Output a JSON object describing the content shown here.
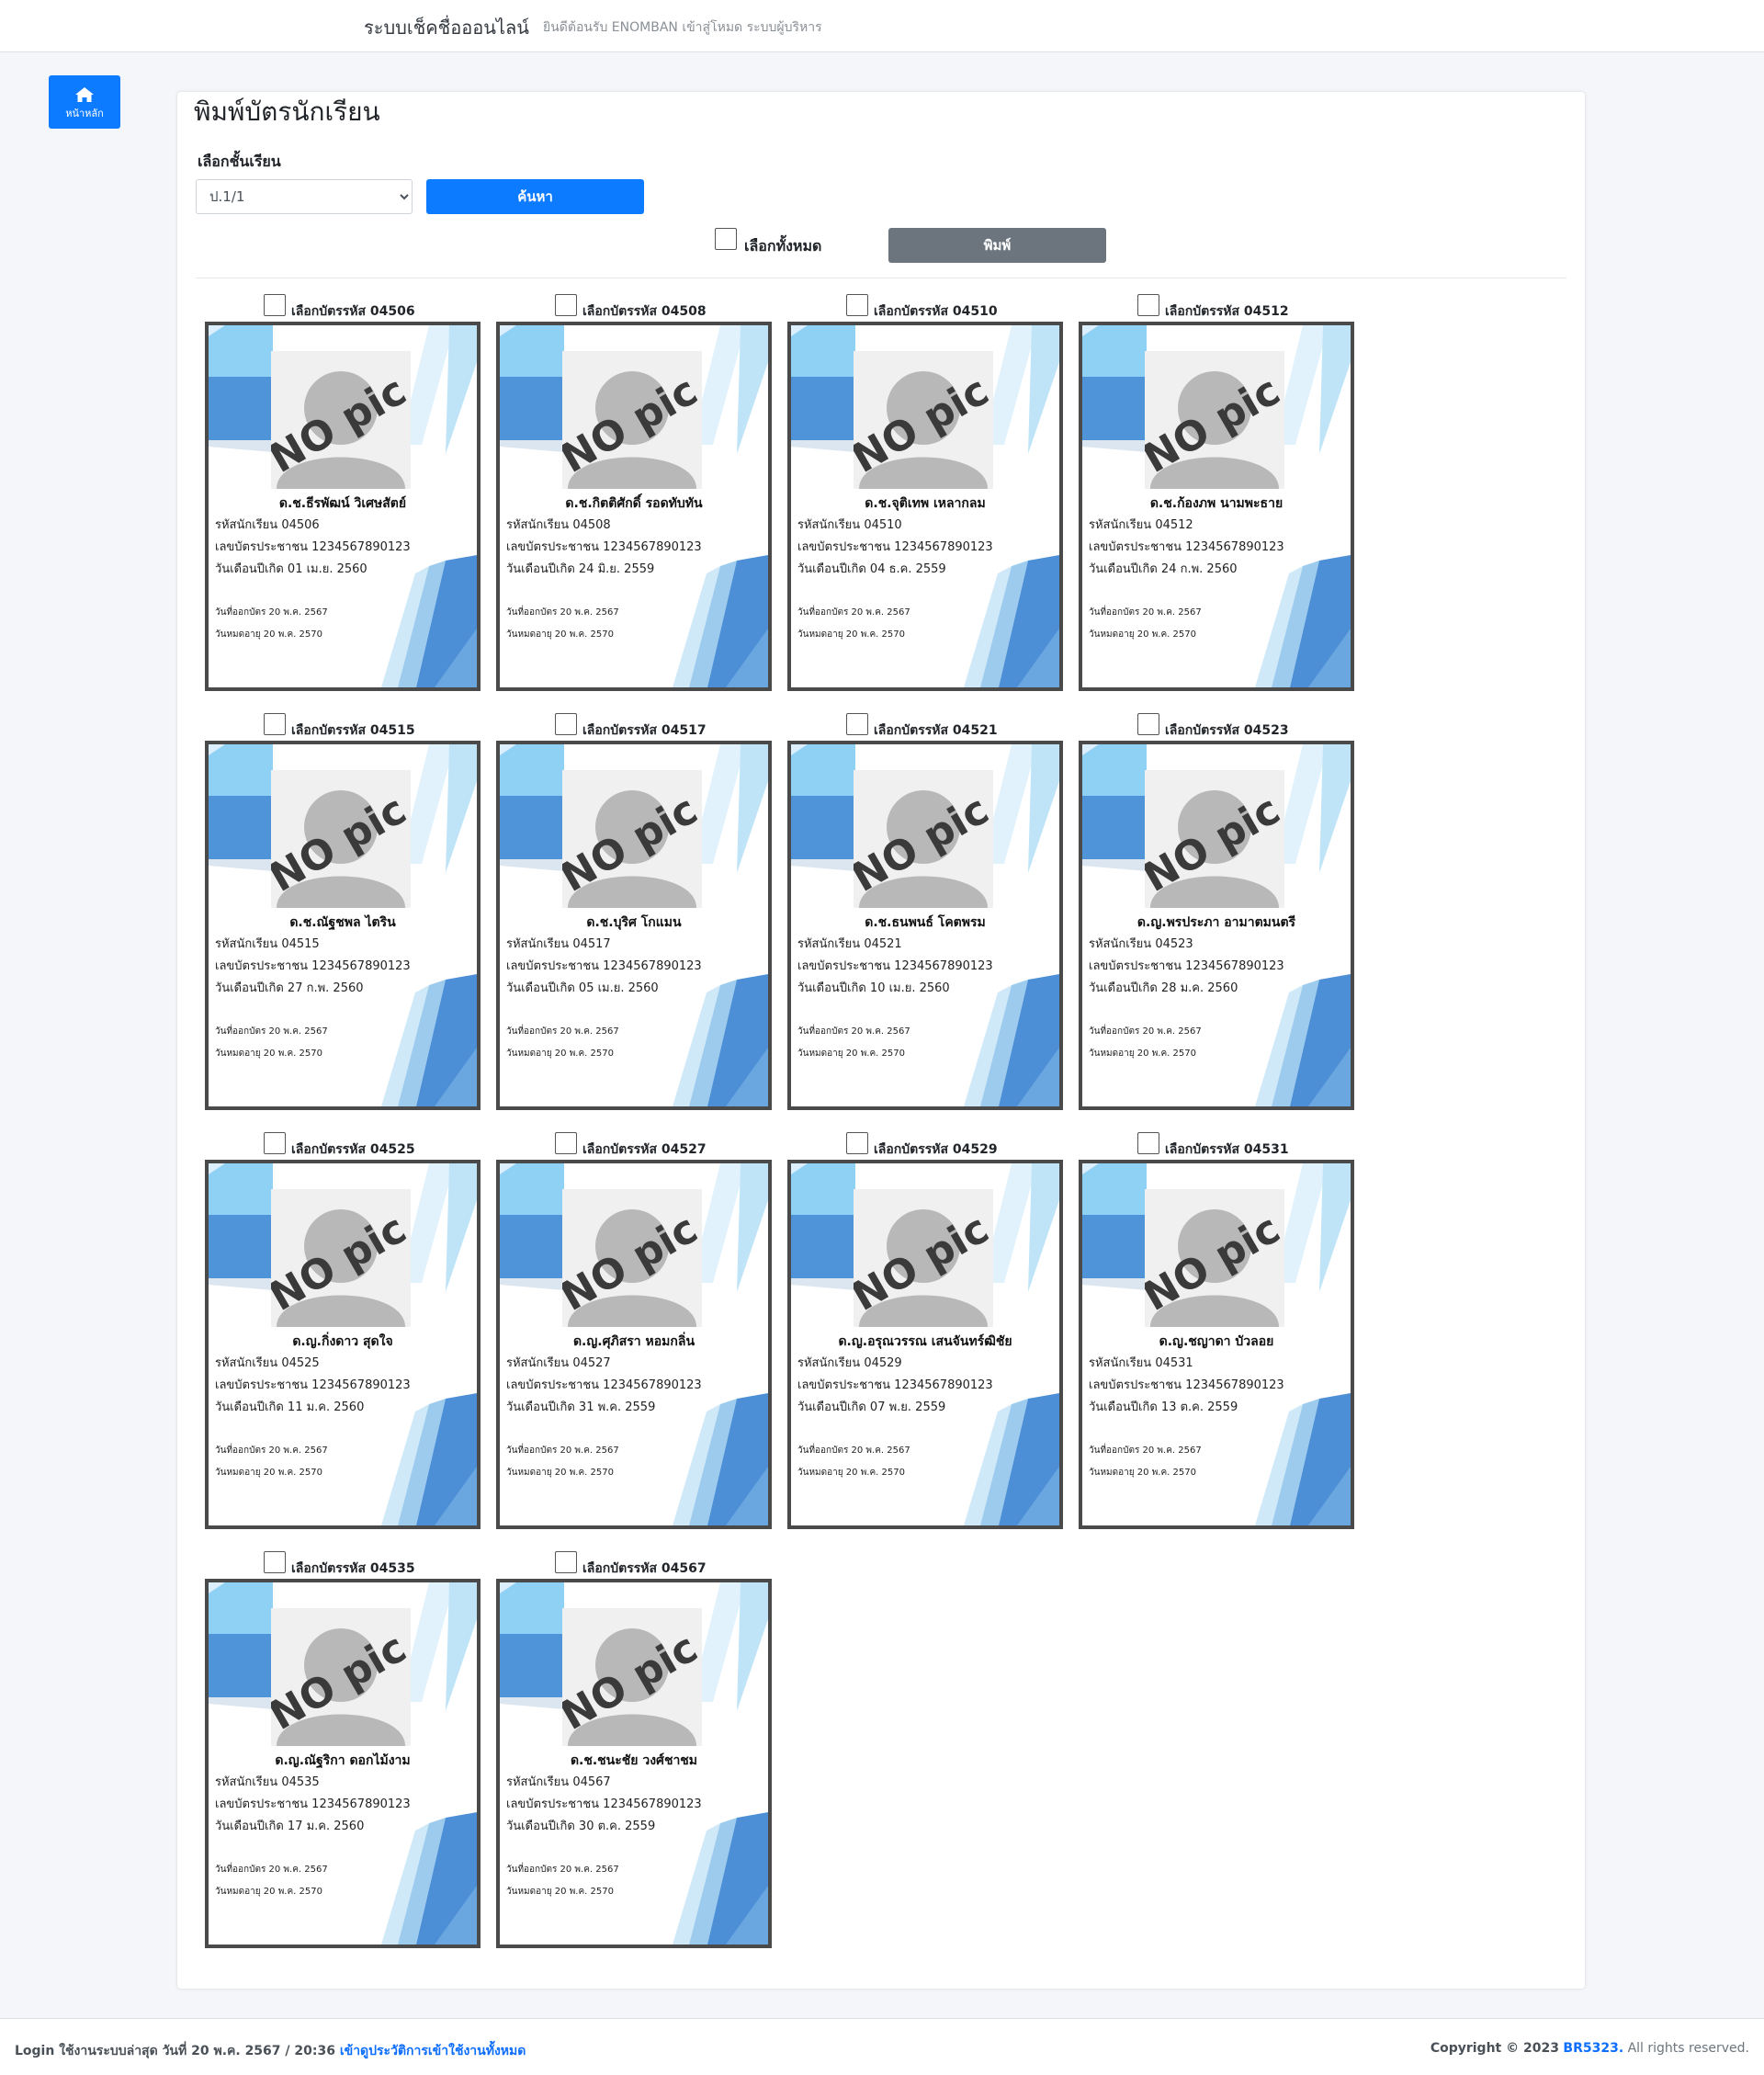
{
  "header": {
    "brand": "ระบบเช็คชื่อออนไลน์",
    "welcome": "ยินดีต้อนรับ ENOMBAN เข้าสู่โหมด ระบบผู้บริหาร"
  },
  "sidebar": {
    "home_label": "หน้าหลัก",
    "home_icon": "home-icon"
  },
  "main": {
    "title": "พิมพ์บัตรนักเรียน",
    "class_label": "เลือกชั้นเรียน",
    "class_selected": "ป.1/1",
    "search_label": "ค้นหา",
    "select_all_label": "เลือกทั้งหมด",
    "print_label": "พิมพ์"
  },
  "card_labels": {
    "select_prefix": "เลือกบัตรรหัส",
    "student_id": "รหัสนักเรียน",
    "national_id": "เลขบัตรประชาชน",
    "birth_date": "วันเดือนปีเกิด",
    "issue_date": "วันที่ออกบัตร",
    "expiry_date": "วันหมดอายุ",
    "photo_placeholder": "NO pic"
  },
  "cards": [
    {
      "code": "04506",
      "name": "ด.ช.ธีรพัฒน์ วิเศษสัตย์",
      "national_id": "1234567890123",
      "birth": "01 เม.ย. 2560",
      "issued": "20 พ.ค. 2567",
      "expires": "20 พ.ค. 2570"
    },
    {
      "code": "04508",
      "name": "ด.ช.กิตติศักดิ์ รอดทับทัน",
      "national_id": "1234567890123",
      "birth": "24 มิ.ย. 2559",
      "issued": "20 พ.ค. 2567",
      "expires": "20 พ.ค. 2570"
    },
    {
      "code": "04510",
      "name": "ด.ช.จุติเทพ เหลากลม",
      "national_id": "1234567890123",
      "birth": "04 ธ.ค. 2559",
      "issued": "20 พ.ค. 2567",
      "expires": "20 พ.ค. 2570"
    },
    {
      "code": "04512",
      "name": "ด.ช.ก้องภพ นามพะธาย",
      "national_id": "1234567890123",
      "birth": "24 ก.พ. 2560",
      "issued": "20 พ.ค. 2567",
      "expires": "20 พ.ค. 2570"
    },
    {
      "code": "04515",
      "name": "ด.ช.ณัฐชพล ไตริน",
      "national_id": "1234567890123",
      "birth": "27 ก.พ. 2560",
      "issued": "20 พ.ค. 2567",
      "expires": "20 พ.ค. 2570"
    },
    {
      "code": "04517",
      "name": "ด.ช.บุริศ โกแมน",
      "national_id": "1234567890123",
      "birth": "05 เม.ย. 2560",
      "issued": "20 พ.ค. 2567",
      "expires": "20 พ.ค. 2570"
    },
    {
      "code": "04521",
      "name": "ด.ช.ธนพนธ์ โคตพรม",
      "national_id": "1234567890123",
      "birth": "10 เม.ย. 2560",
      "issued": "20 พ.ค. 2567",
      "expires": "20 พ.ค. 2570"
    },
    {
      "code": "04523",
      "name": "ด.ญ.พรประภา อามาตมนตรี",
      "national_id": "1234567890123",
      "birth": "28 ม.ค. 2560",
      "issued": "20 พ.ค. 2567",
      "expires": "20 พ.ค. 2570"
    },
    {
      "code": "04525",
      "name": "ด.ญ.กิ่งดาว สุดใจ",
      "national_id": "1234567890123",
      "birth": "11 ม.ค. 2560",
      "issued": "20 พ.ค. 2567",
      "expires": "20 พ.ค. 2570"
    },
    {
      "code": "04527",
      "name": "ด.ญ.ศุภิสรา หอมกลิ่น",
      "national_id": "1234567890123",
      "birth": "31 พ.ค. 2559",
      "issued": "20 พ.ค. 2567",
      "expires": "20 พ.ค. 2570"
    },
    {
      "code": "04529",
      "name": "ด.ญ.อรุณวรรณ เสนจันทร์ฒิชัย",
      "national_id": "1234567890123",
      "birth": "07 พ.ย. 2559",
      "issued": "20 พ.ค. 2567",
      "expires": "20 พ.ค. 2570"
    },
    {
      "code": "04531",
      "name": "ด.ญ.ชญาดา บัวลอย",
      "national_id": "1234567890123",
      "birth": "13 ต.ค. 2559",
      "issued": "20 พ.ค. 2567",
      "expires": "20 พ.ค. 2570"
    },
    {
      "code": "04535",
      "name": "ด.ญ.ณัฐริกา ดอกไม้งาม",
      "national_id": "1234567890123",
      "birth": "17 ม.ค. 2560",
      "issued": "20 พ.ค. 2567",
      "expires": "20 พ.ค. 2570"
    },
    {
      "code": "04567",
      "name": "ด.ช.ชนะชัย วงศ์ชาชม",
      "national_id": "1234567890123",
      "birth": "30 ต.ค. 2559",
      "issued": "20 พ.ค. 2567",
      "expires": "20 พ.ค. 2570"
    }
  ],
  "footer": {
    "login_text": "Login ใช้งานระบบล่าสุด วันที่ 20 พ.ค. 2567 / 20:36",
    "login_link": "เข้าดูประวัติการเข้าใช้งานทั้งหมด",
    "copyright_prefix": "Copyright © 2023",
    "copyright_brand": "BR5323.",
    "copyright_suffix": "All rights reserved."
  }
}
